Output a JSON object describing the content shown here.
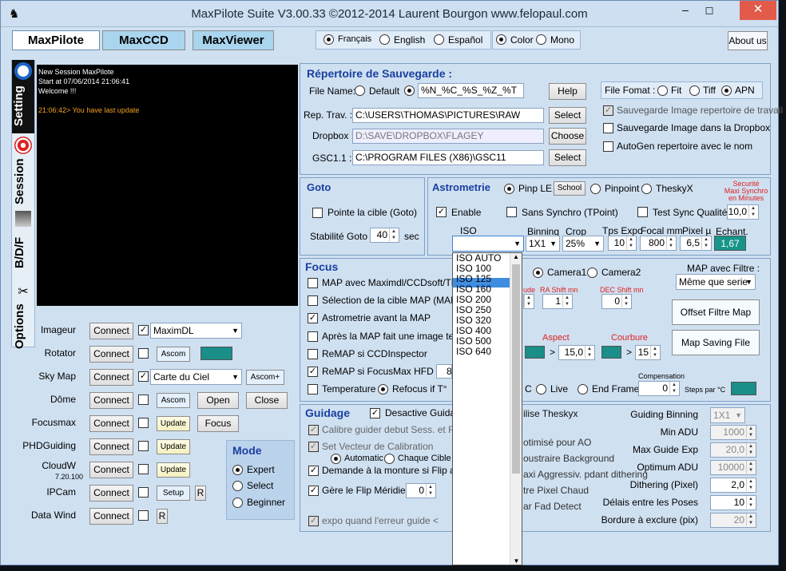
{
  "title": "MaxPilote Suite  V3.00.33  ©2012-2014 Laurent Bourgon  www.felopaul.com",
  "apps": [
    "MaxPilote",
    "MaxCCD",
    "MaxViewer"
  ],
  "languages": [
    "Français",
    "English",
    "Español"
  ],
  "color_modes": [
    "Color",
    "Mono"
  ],
  "about": "About us",
  "side_tabs": [
    "Setting",
    "Session",
    "B/D/F",
    "Options"
  ],
  "console": [
    "New Session MaxPilote",
    "Start at 07/06/2014 21:06:41",
    "Welcome !!!",
    "",
    "21:06:42> You have last update"
  ],
  "devices": [
    {
      "name": "Imageur",
      "checked": true,
      "value": "MaximDL"
    },
    {
      "name": "Rotator",
      "checked": false,
      "extra": "Ascom"
    },
    {
      "name": "Sky Map",
      "checked": true,
      "value": "Carte du Ciel",
      "extra": "Ascom+"
    },
    {
      "name": "Dôme",
      "checked": false,
      "extra": "Ascom",
      "b1": "Open",
      "b2": "Close"
    },
    {
      "name": "Focusmax",
      "checked": false,
      "extra": "Update",
      "b1": "Focus"
    },
    {
      "name": "PHDGuiding",
      "checked": false,
      "extra": "Update"
    },
    {
      "name": "CloudW",
      "sub": "7.20.100",
      "checked": false,
      "extra": "Update"
    },
    {
      "name": "IPCam",
      "checked": false,
      "extra": "Setup",
      "r": "R"
    },
    {
      "name": "Data Wind",
      "checked": false,
      "r": "R"
    }
  ],
  "connect": "Connect",
  "mode": {
    "title": "Mode",
    "options": [
      "Expert",
      "Select",
      "Beginner"
    ]
  },
  "save": {
    "title": "Répertoire de Sauvegarde :",
    "file_name": "File Name:",
    "default": "Default",
    "pattern": "%N_%C_%S_%Z_%T",
    "help": "Help",
    "rep_trav": "Rep. Trav. :",
    "rep_val": "C:\\USERS\\THOMAS\\PICTURES\\RAW",
    "dropbox": "Dropbox :",
    "dropbox_val": "D:\\SAVE\\DROPBOX\\FLAGEY",
    "gsc": "GSC1.1 :",
    "gsc_val": "C:\\PROGRAM FILES (X86)\\GSC11",
    "select": "Select",
    "choose": "Choose",
    "file_format": "File Fomat :",
    "formats": [
      "Fit",
      "Tiff",
      "APN"
    ],
    "opts": [
      "Sauvegarde Image repertoire de travail",
      "Sauvegarde Image dans la  Dropbox",
      "AutoGen repertoire avec le nom"
    ]
  },
  "goto": {
    "title": "Goto",
    "pointe": "Pointe la cible (Goto)",
    "stab": "Stabilité Goto",
    "stab_val": "40",
    "sec": "sec"
  },
  "astro": {
    "title": "Astrometrie",
    "solvers": [
      "Pinp LE",
      "Pinpoint",
      "TheskyX"
    ],
    "school": "School",
    "securite": [
      "Securité",
      "Maxi Synchro",
      "en Minutes"
    ],
    "enable": "Enable",
    "sans": "Sans Synchro (TPoint)",
    "test": "Test Sync Qualité",
    "test_val": "10,0",
    "iso": "ISO",
    "binning": "Binning",
    "bin_val": "1X1",
    "crop": "Crop",
    "crop_val": "25%",
    "tps": "Tps Expo",
    "tps_val": "10",
    "focal": "Focal mm",
    "focal_val": "800",
    "pixel": "Pixel µ",
    "pixel_val": "6,5",
    "echant": "Echant.",
    "echant_val": "1,67"
  },
  "iso_list": [
    "ISO AUTO",
    "ISO 100",
    "ISO 125",
    "ISO 160",
    "ISO 200",
    "ISO 250",
    "ISO 320",
    "ISO 400",
    "ISO 500",
    "ISO 640"
  ],
  "focus": {
    "title": "Focus",
    "items": [
      "MAP avec Maximdl/CCDsoft/Thes",
      "Sélection de la cible MAP (MAP ma",
      "Astrometrie avant la MAP",
      "Après la MAP fait une image test",
      "ReMAP si CCDInspector",
      "ReMAP si FocusMax HFD >",
      "Temperature"
    ],
    "refocus": "Refocus if  T°",
    "cam1": "Camera1",
    "cam2": "Camera2",
    "map_filtre": "MAP avec Filtre :",
    "filtre_val": "Même que serie",
    "offset": "Offset Filtre Map",
    "saving": "Map Saving File",
    "ra": "RA Shift mn",
    "dec": "DEC Shift mn",
    "ra_val": "1",
    "dec_val": "0",
    "ude": "ude",
    "aspect": "Aspect",
    "courbure": "Courbure",
    "asp_val": "15,0",
    "cour_val": "15",
    "hfd_val": "8",
    "live": "Live",
    "endframe": "End Frame",
    "comp": "Compensation",
    "comp_val": "0",
    "steps": "Steps par °C",
    "c": "C"
  },
  "guid": {
    "title": "Guidage",
    "desactive": "Desactive Guidag",
    "left": [
      "Calibre guider debut Sess. et Flip",
      "Set Vecteur de Calibration",
      "Demande à la monture si Flip avan",
      "Gère le Flip Méridien",
      "expo quand  l'erreur guide <"
    ],
    "auto": "Automatic",
    "chaque": "Chaque Cible",
    "flip_val": "0",
    "mid": [
      "ilise Theskyx",
      "otimisé pour  AO",
      "oustraire Background",
      "axi Aggressiv. pdant dithering",
      "tre Pixel Chaud",
      "ar Fad Detect"
    ],
    "right": [
      [
        "Guiding Binning",
        "1X1"
      ],
      [
        "Min ADU",
        "1000"
      ],
      [
        "Max Guide Exp",
        "20,0"
      ],
      [
        "Optimum ADU",
        "10000"
      ],
      [
        "Dithering (Pixel)",
        "2,0"
      ],
      [
        "Délais entre les Poses",
        "10"
      ],
      [
        "Bordure à exclure (pix)",
        "20"
      ]
    ]
  }
}
